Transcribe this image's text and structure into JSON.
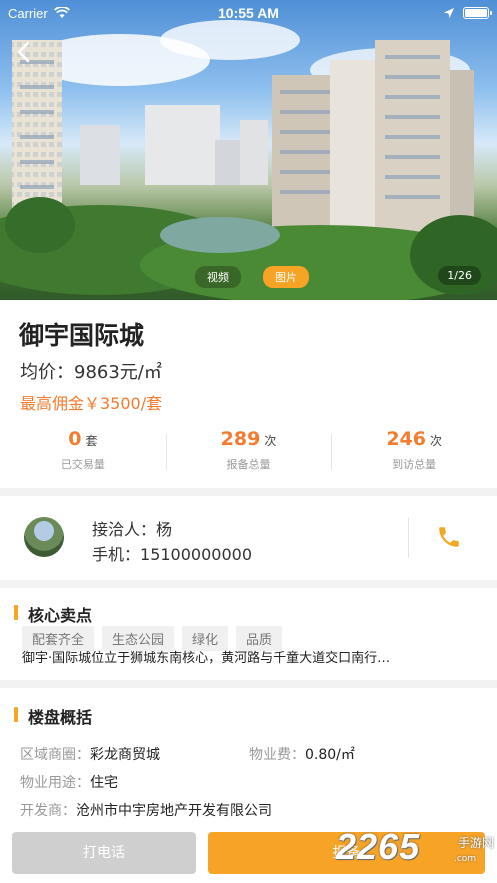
{
  "status_bar": {
    "carrier": "Carrier",
    "time": "10:55 AM"
  },
  "hero": {
    "tabs": [
      {
        "label": "视频"
      },
      {
        "label": "图片"
      }
    ],
    "counter": "1/26"
  },
  "property": {
    "title": "御宇国际城",
    "avg_price_label": "均价：",
    "avg_price": "9863元/㎡",
    "commission": "最高佣金￥3500/套"
  },
  "stats": [
    {
      "value": "0",
      "unit": "套",
      "label": "已交易量"
    },
    {
      "value": "289",
      "unit": "次",
      "label": "报备总量"
    },
    {
      "value": "246",
      "unit": "次",
      "label": "到访总量"
    }
  ],
  "contact": {
    "name_label": "接洽人：",
    "name": "杨",
    "phone_label": "手机：",
    "phone": "15100000000"
  },
  "selling_points": {
    "title": "核心卖点",
    "tags": [
      "配套齐全",
      "生态公园",
      "绿化",
      "品质"
    ],
    "description": "御宇·国际城位立于狮城东南核心，黄河路与千童大道交口南行…"
  },
  "overview": {
    "title": "楼盘概括",
    "district_label": "区域商圈：",
    "district": "彩龙商贸城",
    "fee_label": "物业费：",
    "fee": "0.80/㎡",
    "usage_label": "物业用途：",
    "usage": "住宅",
    "developer_label": "开发商：",
    "developer": "沧州市中宇房地产开发有限公司"
  },
  "actions": {
    "call": "打电话",
    "report": "报备"
  },
  "watermark": {
    "big": "2265",
    "small1": "手游网",
    "small2": ".com"
  },
  "colors": {
    "accent": "#f7a326",
    "price": "#f57c2e"
  }
}
